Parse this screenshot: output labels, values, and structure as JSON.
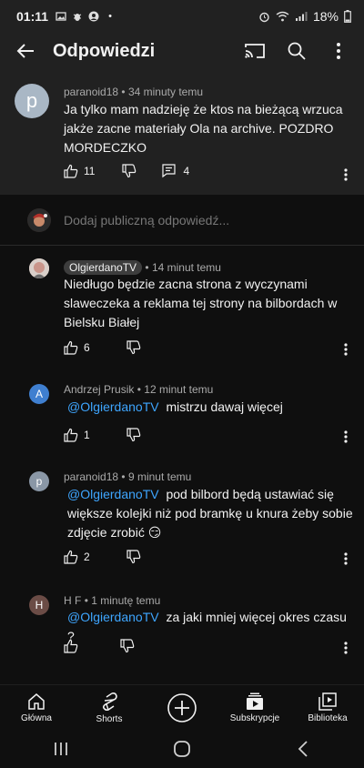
{
  "status": {
    "time": "01:11",
    "battery": "18%"
  },
  "appbar": {
    "title": "Odpowiedzi"
  },
  "top_comment": {
    "avatar_letter": "p",
    "author": "paranoid18",
    "time": "34 minuty temu",
    "text": "Ja tylko mam nadzieję że ktos na bieżącą wrzuca jakże zacne materiały Ola na archive. POZDRO MORDECZKO",
    "likes": "11",
    "replies": "4"
  },
  "reply_input": {
    "placeholder": "Dodaj publiczną odpowiedź..."
  },
  "comments": [
    {
      "author": "OlgierdanoTV",
      "time": "14 minut temu",
      "text": "Niedługo będzie zacna strona z wyczynami slaweczeka a reklama tej strony na bilbordach w Bielsku Białej",
      "likes": "6"
    },
    {
      "avatar_letter": "A",
      "author": "Andrzej Prusik",
      "time": "12 minut temu",
      "mention": "@OlgierdanoTV",
      "text": "mistrzu dawaj więcej",
      "likes": "1"
    },
    {
      "avatar_letter": "p",
      "author": "paranoid18",
      "time": "9 minut temu",
      "mention": "@OlgierdanoTV",
      "text_first": "pod bilbord będą ustawiać się",
      "text_rest": "większe kolejki niż pod bramkę u knura żeby sobie zdjęcie zrobić 😏",
      "likes": "2"
    },
    {
      "avatar_letter": "H",
      "author": "H F",
      "time": "1 minutę temu",
      "mention": "@OlgierdanoTV",
      "text": "za jaki mniej więcej okres czasu ?",
      "likes": ""
    }
  ],
  "bottom_nav": [
    {
      "label": "Główna",
      "icon": "home-icon"
    },
    {
      "label": "Shorts",
      "icon": "shorts-icon"
    },
    {
      "label": "",
      "icon": "create-plus-icon"
    },
    {
      "label": "Subskrypcje",
      "icon": "subscriptions-icon"
    },
    {
      "label": "Biblioteka",
      "icon": "library-icon"
    }
  ],
  "colors": {
    "background": "#0f0f0f",
    "surface": "#212121",
    "mention": "#3ea6ff",
    "secondary_text": "#aaaaaa"
  }
}
